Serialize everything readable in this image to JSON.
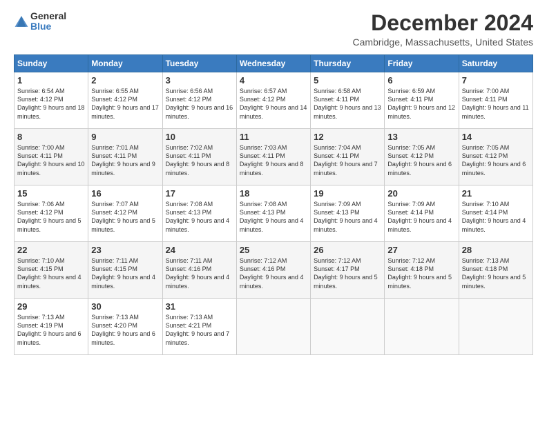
{
  "logo": {
    "general": "General",
    "blue": "Blue"
  },
  "title": "December 2024",
  "subtitle": "Cambridge, Massachusetts, United States",
  "days_header": [
    "Sunday",
    "Monday",
    "Tuesday",
    "Wednesday",
    "Thursday",
    "Friday",
    "Saturday"
  ],
  "weeks": [
    [
      {
        "num": "1",
        "sunrise": "Sunrise: 6:54 AM",
        "sunset": "Sunset: 4:12 PM",
        "daylight": "Daylight: 9 hours and 18 minutes."
      },
      {
        "num": "2",
        "sunrise": "Sunrise: 6:55 AM",
        "sunset": "Sunset: 4:12 PM",
        "daylight": "Daylight: 9 hours and 17 minutes."
      },
      {
        "num": "3",
        "sunrise": "Sunrise: 6:56 AM",
        "sunset": "Sunset: 4:12 PM",
        "daylight": "Daylight: 9 hours and 16 minutes."
      },
      {
        "num": "4",
        "sunrise": "Sunrise: 6:57 AM",
        "sunset": "Sunset: 4:12 PM",
        "daylight": "Daylight: 9 hours and 14 minutes."
      },
      {
        "num": "5",
        "sunrise": "Sunrise: 6:58 AM",
        "sunset": "Sunset: 4:11 PM",
        "daylight": "Daylight: 9 hours and 13 minutes."
      },
      {
        "num": "6",
        "sunrise": "Sunrise: 6:59 AM",
        "sunset": "Sunset: 4:11 PM",
        "daylight": "Daylight: 9 hours and 12 minutes."
      },
      {
        "num": "7",
        "sunrise": "Sunrise: 7:00 AM",
        "sunset": "Sunset: 4:11 PM",
        "daylight": "Daylight: 9 hours and 11 minutes."
      }
    ],
    [
      {
        "num": "8",
        "sunrise": "Sunrise: 7:00 AM",
        "sunset": "Sunset: 4:11 PM",
        "daylight": "Daylight: 9 hours and 10 minutes."
      },
      {
        "num": "9",
        "sunrise": "Sunrise: 7:01 AM",
        "sunset": "Sunset: 4:11 PM",
        "daylight": "Daylight: 9 hours and 9 minutes."
      },
      {
        "num": "10",
        "sunrise": "Sunrise: 7:02 AM",
        "sunset": "Sunset: 4:11 PM",
        "daylight": "Daylight: 9 hours and 8 minutes."
      },
      {
        "num": "11",
        "sunrise": "Sunrise: 7:03 AM",
        "sunset": "Sunset: 4:11 PM",
        "daylight": "Daylight: 9 hours and 8 minutes."
      },
      {
        "num": "12",
        "sunrise": "Sunrise: 7:04 AM",
        "sunset": "Sunset: 4:11 PM",
        "daylight": "Daylight: 9 hours and 7 minutes."
      },
      {
        "num": "13",
        "sunrise": "Sunrise: 7:05 AM",
        "sunset": "Sunset: 4:12 PM",
        "daylight": "Daylight: 9 hours and 6 minutes."
      },
      {
        "num": "14",
        "sunrise": "Sunrise: 7:05 AM",
        "sunset": "Sunset: 4:12 PM",
        "daylight": "Daylight: 9 hours and 6 minutes."
      }
    ],
    [
      {
        "num": "15",
        "sunrise": "Sunrise: 7:06 AM",
        "sunset": "Sunset: 4:12 PM",
        "daylight": "Daylight: 9 hours and 5 minutes."
      },
      {
        "num": "16",
        "sunrise": "Sunrise: 7:07 AM",
        "sunset": "Sunset: 4:12 PM",
        "daylight": "Daylight: 9 hours and 5 minutes."
      },
      {
        "num": "17",
        "sunrise": "Sunrise: 7:08 AM",
        "sunset": "Sunset: 4:13 PM",
        "daylight": "Daylight: 9 hours and 4 minutes."
      },
      {
        "num": "18",
        "sunrise": "Sunrise: 7:08 AM",
        "sunset": "Sunset: 4:13 PM",
        "daylight": "Daylight: 9 hours and 4 minutes."
      },
      {
        "num": "19",
        "sunrise": "Sunrise: 7:09 AM",
        "sunset": "Sunset: 4:13 PM",
        "daylight": "Daylight: 9 hours and 4 minutes."
      },
      {
        "num": "20",
        "sunrise": "Sunrise: 7:09 AM",
        "sunset": "Sunset: 4:14 PM",
        "daylight": "Daylight: 9 hours and 4 minutes."
      },
      {
        "num": "21",
        "sunrise": "Sunrise: 7:10 AM",
        "sunset": "Sunset: 4:14 PM",
        "daylight": "Daylight: 9 hours and 4 minutes."
      }
    ],
    [
      {
        "num": "22",
        "sunrise": "Sunrise: 7:10 AM",
        "sunset": "Sunset: 4:15 PM",
        "daylight": "Daylight: 9 hours and 4 minutes."
      },
      {
        "num": "23",
        "sunrise": "Sunrise: 7:11 AM",
        "sunset": "Sunset: 4:15 PM",
        "daylight": "Daylight: 9 hours and 4 minutes."
      },
      {
        "num": "24",
        "sunrise": "Sunrise: 7:11 AM",
        "sunset": "Sunset: 4:16 PM",
        "daylight": "Daylight: 9 hours and 4 minutes."
      },
      {
        "num": "25",
        "sunrise": "Sunrise: 7:12 AM",
        "sunset": "Sunset: 4:16 PM",
        "daylight": "Daylight: 9 hours and 4 minutes."
      },
      {
        "num": "26",
        "sunrise": "Sunrise: 7:12 AM",
        "sunset": "Sunset: 4:17 PM",
        "daylight": "Daylight: 9 hours and 5 minutes."
      },
      {
        "num": "27",
        "sunrise": "Sunrise: 7:12 AM",
        "sunset": "Sunset: 4:18 PM",
        "daylight": "Daylight: 9 hours and 5 minutes."
      },
      {
        "num": "28",
        "sunrise": "Sunrise: 7:13 AM",
        "sunset": "Sunset: 4:18 PM",
        "daylight": "Daylight: 9 hours and 5 minutes."
      }
    ],
    [
      {
        "num": "29",
        "sunrise": "Sunrise: 7:13 AM",
        "sunset": "Sunset: 4:19 PM",
        "daylight": "Daylight: 9 hours and 6 minutes."
      },
      {
        "num": "30",
        "sunrise": "Sunrise: 7:13 AM",
        "sunset": "Sunset: 4:20 PM",
        "daylight": "Daylight: 9 hours and 6 minutes."
      },
      {
        "num": "31",
        "sunrise": "Sunrise: 7:13 AM",
        "sunset": "Sunset: 4:21 PM",
        "daylight": "Daylight: 9 hours and 7 minutes."
      },
      null,
      null,
      null,
      null
    ]
  ]
}
